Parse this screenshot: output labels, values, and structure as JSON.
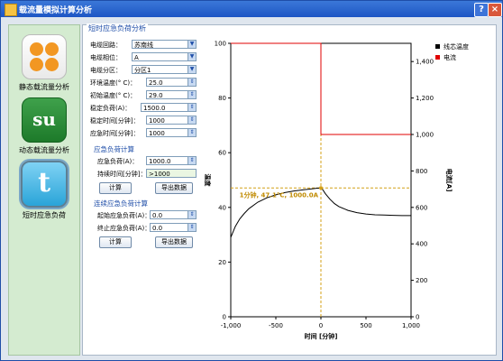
{
  "window": {
    "title": "载流量模拟计算分析",
    "help_label": "?",
    "close_label": "×"
  },
  "sidebar": {
    "items": [
      {
        "label": "静态载流量分析",
        "icon": "orange-dots-icon"
      },
      {
        "label": "动态载流量分析",
        "icon": "stumbleupon-icon"
      },
      {
        "label": "短时应急负荷",
        "icon": "twitter-icon"
      }
    ],
    "active": 2
  },
  "section_title": "短时应急负荷分析",
  "form": {
    "cable_circuit_label": "电缆回路：",
    "cable_circuit_value": "苏南线",
    "cable_phase_label": "电缆相位：",
    "cable_phase_value": "A",
    "cable_partition_label": "电缆分区：",
    "cable_partition_value": "分区1",
    "ambient_temp_label": "环境温度(° C)：",
    "ambient_temp_value": "25.0",
    "initial_temp_label": "初始温度(° C)：",
    "initial_temp_value": "29.0",
    "steady_load_label": "稳定负荷(A)：",
    "steady_load_value": "1500.0",
    "steady_time_label": "稳定时间[分钟]：",
    "steady_time_value": "1000",
    "emergency_time_label": "应急时间[分钟]：",
    "emergency_time_value": "1000"
  },
  "emergency_calc": {
    "title": "应急负荷计算",
    "load_label": "应急负荷(A)：",
    "load_value": "1000.0",
    "duration_label": "持续时间[分钟]：",
    "duration_value": ">1000",
    "calc_button": "计算",
    "export_button": "导出数据"
  },
  "continuous_calc": {
    "title": "连续应急负荷计算",
    "start_label": "起始应急负荷(A)：",
    "start_value": "0.0",
    "end_label": "终止应急负荷(A)：",
    "end_value": "0.0",
    "calc_button": "计算",
    "export_button": "导出数据"
  },
  "chart_data": {
    "type": "line",
    "xlabel": "时间 [分钟]",
    "ylabel_left": "温度",
    "ylabel_right": "电流[A]",
    "xlim": [
      -1000,
      1000
    ],
    "ylim_left": [
      0,
      100
    ],
    "ylim_right": [
      0,
      1500
    ],
    "x_ticks": [
      "-1,000",
      "-500",
      "0",
      "500",
      "1,000"
    ],
    "y_left_ticks": [
      "0",
      "20",
      "40",
      "60",
      "80",
      "100"
    ],
    "y_right_ticks": [
      "0",
      "200",
      "400",
      "600",
      "800",
      "1,000",
      "1,200",
      "1,400"
    ],
    "legend": [
      {
        "name": "线芯温度",
        "color": "#000000"
      },
      {
        "name": "电流",
        "color": "#e00000"
      }
    ],
    "legend_position": "top-right",
    "annotation": {
      "text": "1分钟, 47.1°C, 1000.0A",
      "x": 0,
      "y": 47.1
    },
    "series": [
      {
        "name": "线芯温度",
        "axis": "left",
        "color": "#000000",
        "x": [
          -1000,
          -950,
          -900,
          -850,
          -800,
          -700,
          -600,
          -500,
          -400,
          -300,
          -200,
          -100,
          -50,
          0,
          20,
          50,
          100,
          150,
          200,
          300,
          400,
          500,
          600,
          700,
          800,
          900,
          1000
        ],
        "y": [
          29.0,
          33.0,
          35.8,
          37.8,
          39.5,
          41.9,
          43.5,
          44.6,
          45.4,
          46.0,
          46.4,
          46.8,
          47.0,
          47.1,
          46.5,
          45.0,
          43.0,
          41.4,
          40.3,
          38.9,
          38.1,
          37.6,
          37.3,
          37.2,
          37.1,
          37.0,
          37.0
        ]
      },
      {
        "name": "电流",
        "axis": "right",
        "color": "#e00000",
        "x": [
          -1000,
          0,
          0,
          1000
        ],
        "y": [
          1500,
          1500,
          1000,
          1000
        ]
      }
    ]
  }
}
